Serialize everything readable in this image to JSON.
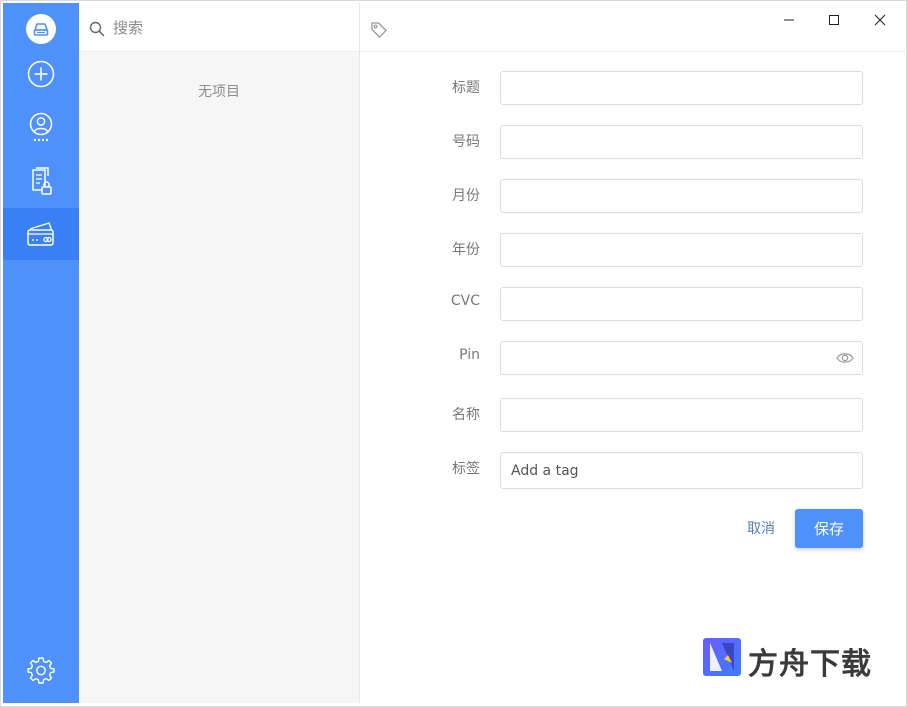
{
  "sidebar": {
    "items": [
      {
        "name": "logo",
        "icon": "app-logo-icon"
      },
      {
        "name": "add",
        "icon": "plus-circle-icon"
      },
      {
        "name": "accounts",
        "icon": "user-circle-icon"
      },
      {
        "name": "notes",
        "icon": "locked-document-icon"
      },
      {
        "name": "cards",
        "icon": "credit-card-icon",
        "active": true
      }
    ],
    "settings_icon": "gear-icon"
  },
  "list": {
    "search_placeholder": "搜索",
    "empty_text": "无项目"
  },
  "form": {
    "fields": [
      {
        "label": "标题",
        "value": ""
      },
      {
        "label": "号码",
        "value": ""
      },
      {
        "label": "月份",
        "value": ""
      },
      {
        "label": "年份",
        "value": ""
      },
      {
        "label": "CVC",
        "value": ""
      },
      {
        "label": "Pin",
        "value": ""
      },
      {
        "label": "名称",
        "value": ""
      },
      {
        "label": "标签",
        "placeholder": "Add a tag"
      }
    ],
    "cancel_label": "取消",
    "save_label": "保存"
  },
  "watermark": {
    "text": "方舟下载"
  },
  "colors": {
    "accent": "#4e91fb",
    "sidebar_active": "#3a80f5"
  }
}
